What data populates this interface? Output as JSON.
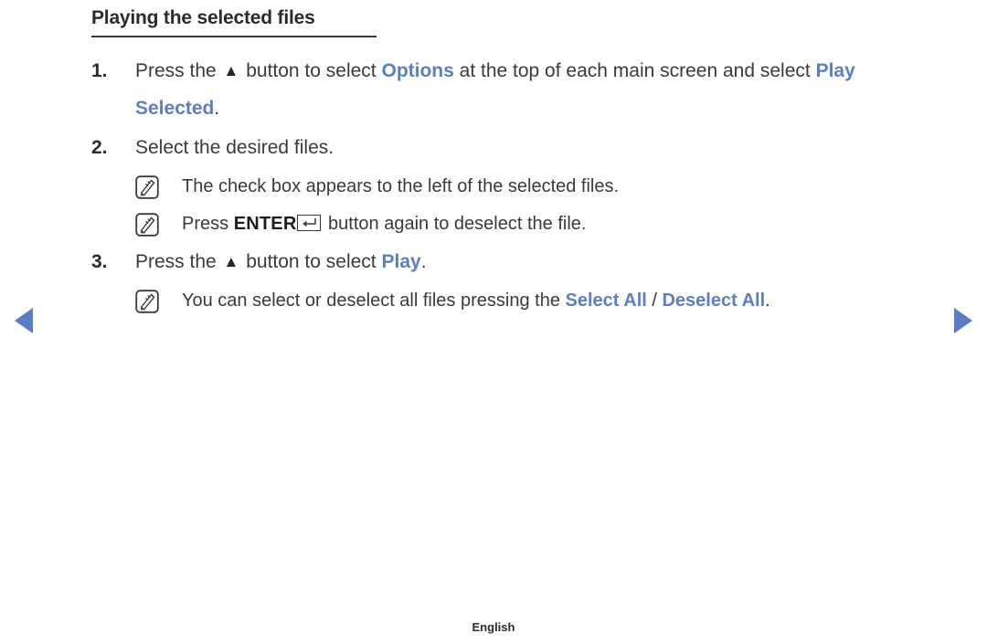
{
  "document": {
    "heading": "Playing the selected files",
    "footer_language": "English"
  },
  "steps": [
    {
      "number": "1.",
      "parts": {
        "t1": "Press the ",
        "arrow": "▲",
        "t2": " button to select ",
        "hl1": "Options",
        "t3": " at the top of each main screen and select ",
        "hl2": "Play Selected",
        "t4": "."
      }
    },
    {
      "number": "2.",
      "parts": {
        "t1": "Select the desired files."
      }
    },
    {
      "number": "3.",
      "parts": {
        "t1": "Press the ",
        "arrow": "▲",
        "t2": " button to select ",
        "hl1": "Play",
        "t3": "."
      }
    }
  ],
  "notes": {
    "note_checkbox": {
      "icon": "note-pencil-icon",
      "text": "The check box appears to the left of the selected files."
    },
    "note_enter": {
      "icon": "note-pencil-icon",
      "t1": "Press ",
      "key_label": "ENTER",
      "key_symbol": "enter-return-key-icon",
      "t2": " button again to deselect the file."
    },
    "note_selectall": {
      "icon": "note-pencil-icon",
      "t1": "You can select or deselect all files pressing the ",
      "hl1": "Select All",
      "sep": " / ",
      "hl2": "Deselect All",
      "t2": "."
    }
  },
  "navigation": {
    "prev_icon": "triangle-left-icon",
    "next_icon": "triangle-right-icon"
  },
  "colors": {
    "accent_blue": "#5b7fc4",
    "nav_blue": "#5a7cc0",
    "text": "#3a3a3a",
    "heading": "#2b2b2b"
  }
}
